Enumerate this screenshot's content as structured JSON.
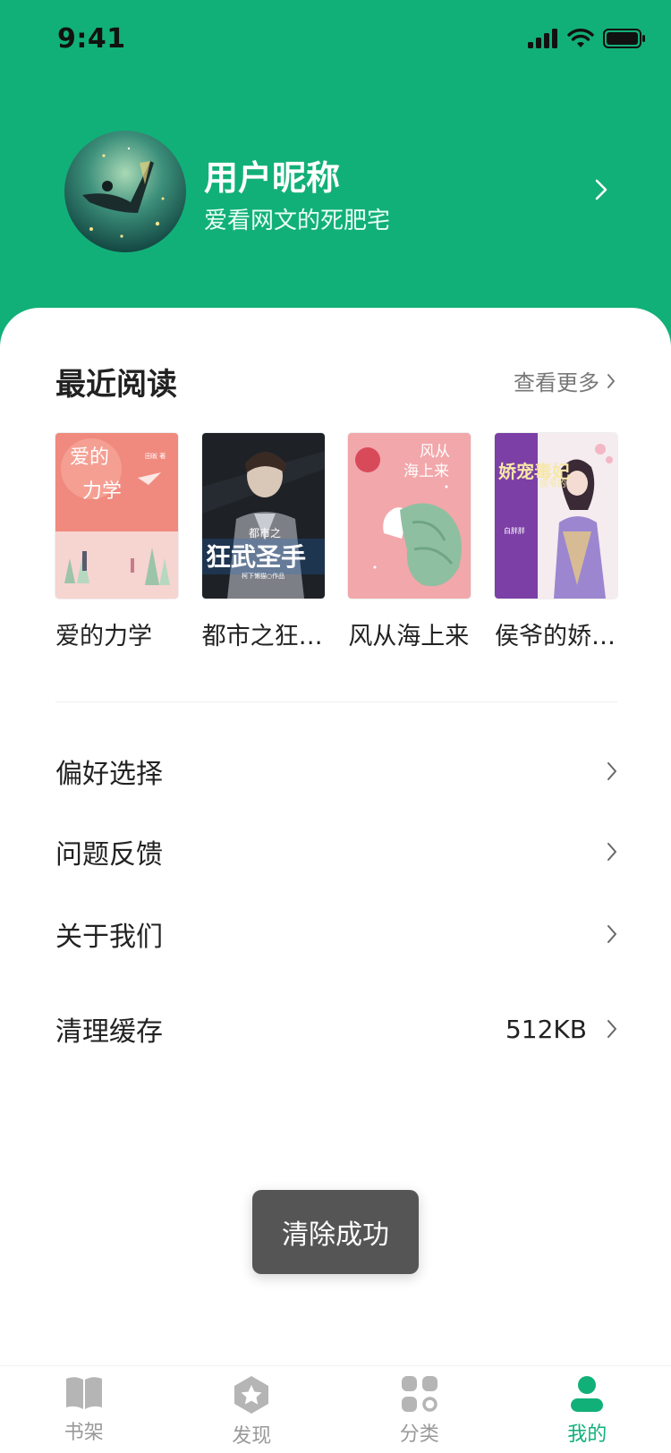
{
  "status_bar": {
    "time": "9:41"
  },
  "profile": {
    "nickname": "用户昵称",
    "bio": "爱看网文的死肥宅"
  },
  "recent": {
    "title": "最近阅读",
    "see_more": "查看更多",
    "books": [
      {
        "title": "爱的力学",
        "cover_text": [
          "爱的",
          "力学"
        ],
        "cover_author": "田昄 著"
      },
      {
        "title": "都市之狂…",
        "cover_text": [
          "都市之",
          "狂武圣手"
        ],
        "cover_author": "柯下懒猫○作品"
      },
      {
        "title": "风从海上来",
        "cover_text": [
          "风从",
          "海上来"
        ],
        "cover_author": ""
      },
      {
        "title": "侯爷的娇…",
        "cover_text": [
          "娇宠毒妃",
          "侯爷的"
        ],
        "cover_author": "白胖胖"
      }
    ]
  },
  "menu": [
    {
      "label": "偏好选择",
      "value": ""
    },
    {
      "label": "问题反馈",
      "value": ""
    },
    {
      "label": "关于我们",
      "value": ""
    },
    {
      "label": "清理缓存",
      "value": "512KB"
    }
  ],
  "toast": {
    "text": "清除成功"
  },
  "tabbar": {
    "active_index": 3,
    "tabs": [
      {
        "label": "书架",
        "icon": "book-open-icon"
      },
      {
        "label": "发现",
        "icon": "star-hexagon-icon"
      },
      {
        "label": "分类",
        "icon": "grid-category-icon"
      },
      {
        "label": "我的",
        "icon": "person-icon"
      }
    ]
  },
  "colors": {
    "accent": "#12b079",
    "toast_bg": "#555555",
    "tab_inactive": "#999999"
  }
}
